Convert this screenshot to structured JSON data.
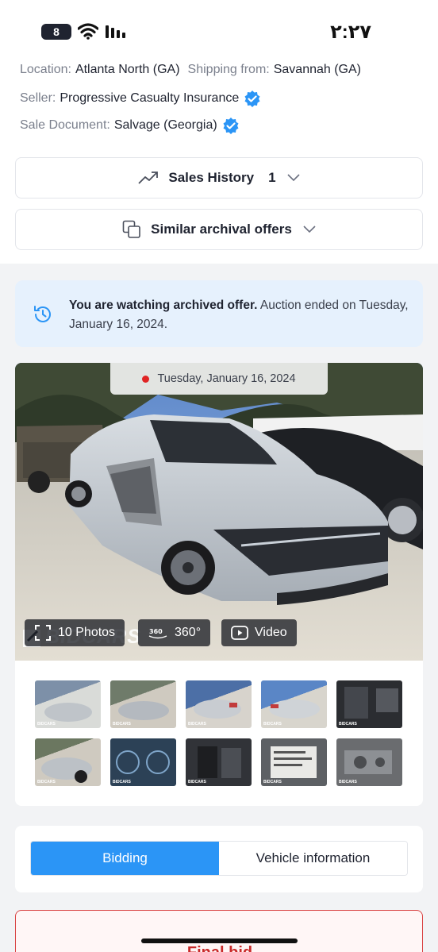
{
  "status_bar": {
    "battery": "8",
    "time": "٢:٢٧"
  },
  "lot_info": {
    "location_label": "Location:",
    "location_value": "Atlanta North (GA)",
    "shipping_label": "Shipping from:",
    "shipping_value": "Savannah (GA)",
    "seller_label": "Seller:",
    "seller_value": "Progressive Casualty Insurance",
    "sale_doc_label": "Sale Document:",
    "sale_doc_value": "Salvage (Georgia)"
  },
  "sales_history": {
    "label": "Sales History",
    "count": "1"
  },
  "similar_offers": {
    "label": "Similar archival offers"
  },
  "archived_notice": {
    "bold": "You are watching archived offer.",
    "rest": " Auction ended on Tuesday, January 16, 2024."
  },
  "gallery": {
    "date": "Tuesday, January 16, 2024",
    "photos_label": "10 Photos",
    "view360_label": "360°",
    "video_label": "Video",
    "watermark": "BIDCARS",
    "thumb_watermark": "BIDCARS"
  },
  "tabs": {
    "bidding": "Bidding",
    "vehicle_info": "Vehicle information"
  },
  "final_bid": {
    "title": "Final bid"
  },
  "colors": {
    "accent": "#2b95f6",
    "verified": "#2b95f6",
    "final_bid_border": "#d94343"
  }
}
